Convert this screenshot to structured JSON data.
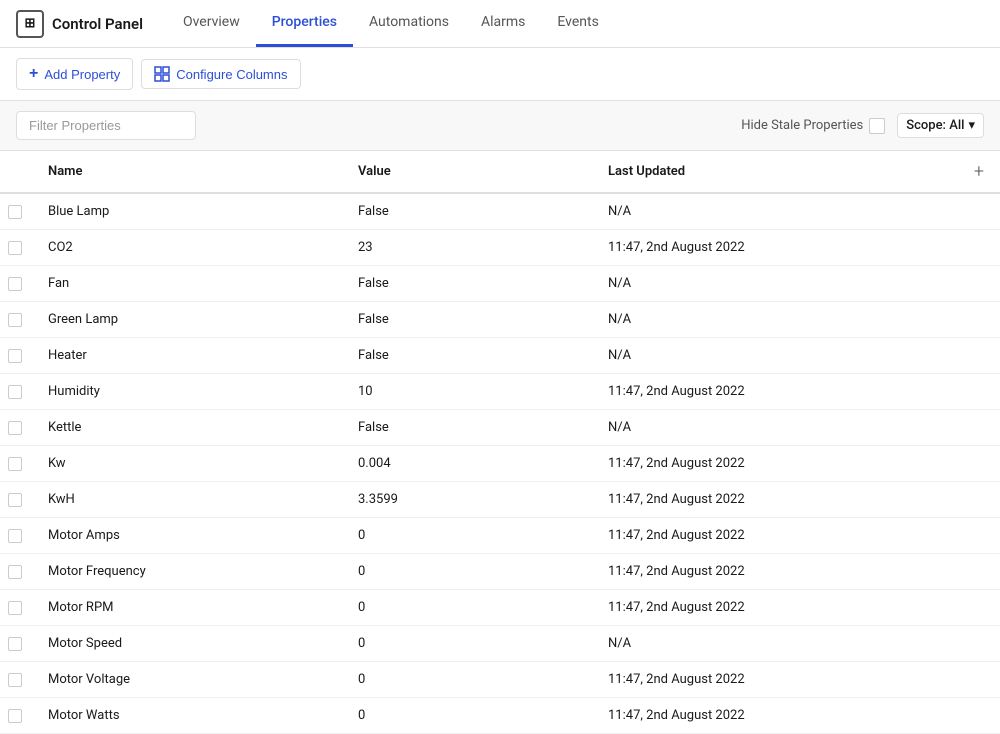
{
  "brand": {
    "label": "Control Panel",
    "icon": "⊞"
  },
  "nav": {
    "tabs": [
      {
        "id": "overview",
        "label": "Overview",
        "active": false
      },
      {
        "id": "properties",
        "label": "Properties",
        "active": true
      },
      {
        "id": "automations",
        "label": "Automations",
        "active": false
      },
      {
        "id": "alarms",
        "label": "Alarms",
        "active": false
      },
      {
        "id": "events",
        "label": "Events",
        "active": false
      }
    ]
  },
  "toolbar": {
    "add_property_label": "Add Property",
    "configure_columns_label": "Configure Columns"
  },
  "filter": {
    "placeholder": "Filter Properties",
    "hide_stale_label": "Hide Stale Properties",
    "scope_label": "Scope: All"
  },
  "table": {
    "columns": [
      {
        "id": "name",
        "label": "Name"
      },
      {
        "id": "value",
        "label": "Value"
      },
      {
        "id": "last_updated",
        "label": "Last Updated"
      }
    ],
    "rows": [
      {
        "name": "Blue Lamp",
        "value": "False",
        "last_updated": "N/A"
      },
      {
        "name": "CO2",
        "value": "23",
        "last_updated": "11:47, 2nd August 2022"
      },
      {
        "name": "Fan",
        "value": "False",
        "last_updated": "N/A"
      },
      {
        "name": "Green Lamp",
        "value": "False",
        "last_updated": "N/A"
      },
      {
        "name": "Heater",
        "value": "False",
        "last_updated": "N/A"
      },
      {
        "name": "Humidity",
        "value": "10",
        "last_updated": "11:47, 2nd August 2022"
      },
      {
        "name": "Kettle",
        "value": "False",
        "last_updated": "N/A"
      },
      {
        "name": "Kw",
        "value": "0.004",
        "last_updated": "11:47, 2nd August 2022"
      },
      {
        "name": "KwH",
        "value": "3.3599",
        "last_updated": "11:47, 2nd August 2022"
      },
      {
        "name": "Motor Amps",
        "value": "0",
        "last_updated": "11:47, 2nd August 2022"
      },
      {
        "name": "Motor Frequency",
        "value": "0",
        "last_updated": "11:47, 2nd August 2022"
      },
      {
        "name": "Motor RPM",
        "value": "0",
        "last_updated": "11:47, 2nd August 2022"
      },
      {
        "name": "Motor Speed",
        "value": "0",
        "last_updated": "N/A"
      },
      {
        "name": "Motor Voltage",
        "value": "0",
        "last_updated": "11:47, 2nd August 2022"
      },
      {
        "name": "Motor Watts",
        "value": "0",
        "last_updated": "11:47, 2nd August 2022"
      }
    ]
  },
  "colors": {
    "active_tab": "#2c4fd6",
    "brand_text": "#2c4fd6"
  }
}
